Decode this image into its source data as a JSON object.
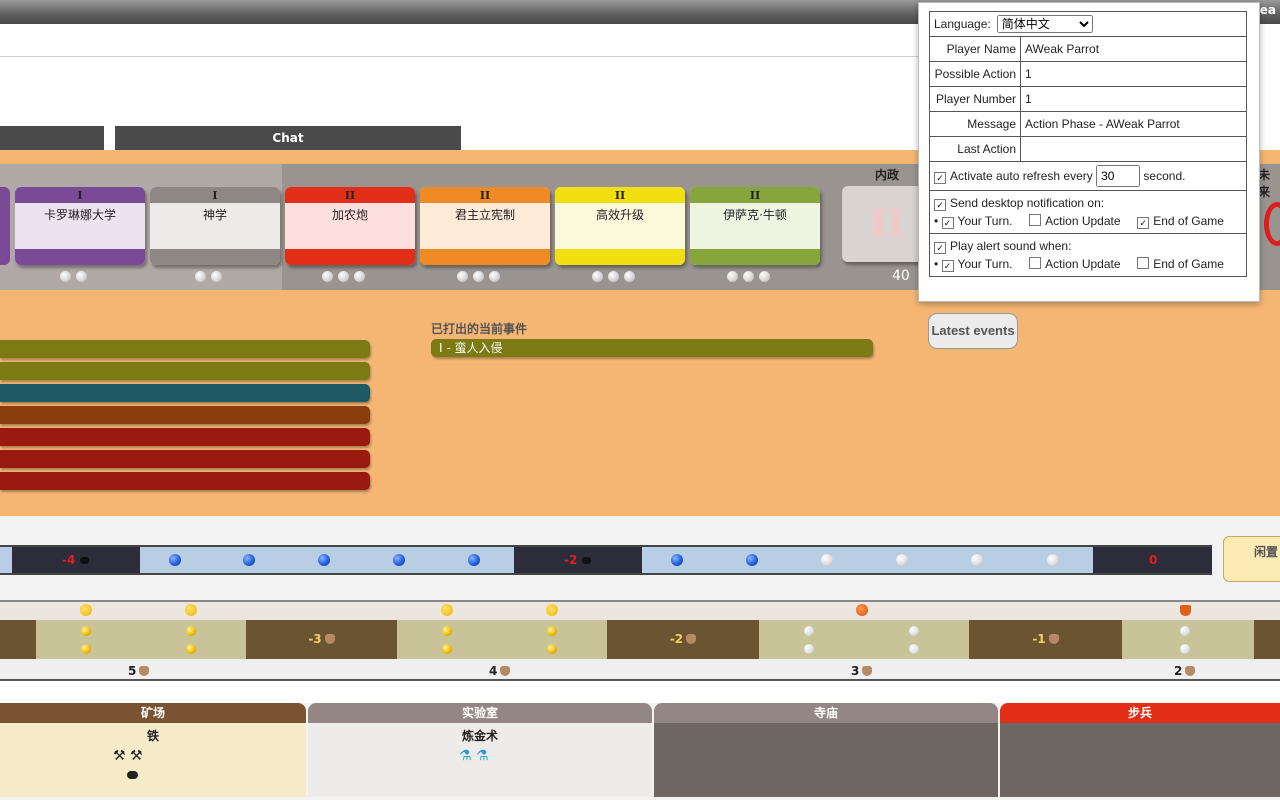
{
  "header": {
    "user_short": "AWea"
  },
  "tabs": {
    "chat": "Chat"
  },
  "cards": [
    {
      "age": "I",
      "name": "卡罗琳娜大学",
      "color": "#7b4a96",
      "body": "#ece2f0",
      "dots": 2
    },
    {
      "age": "I",
      "name": "神学",
      "color": "#8f8784",
      "body": "#ecebea",
      "dots": 2
    },
    {
      "age": "II",
      "name": "加农炮",
      "color": "#e22e16",
      "body": "#fde0de",
      "dots": 3
    },
    {
      "age": "II",
      "name": "君主立宪制",
      "color": "#ef8a24",
      "body": "#fdebd8",
      "dots": 3
    },
    {
      "age": "II",
      "name": "高效升级",
      "color": "#f2df12",
      "body": "#fcf8dc",
      "dots": 3
    },
    {
      "age": "II",
      "name": "伊萨克·牛顿",
      "color": "#86a53b",
      "body": "#eef3e2",
      "dots": 3
    }
  ],
  "civil_deck": {
    "label": "内政",
    "age": "II",
    "count": "40"
  },
  "future_label": "未来",
  "events": {
    "title": "已打出的当前事件",
    "current": "I - 蛮人入侵",
    "latest_button": "Latest events"
  },
  "left_bars": [
    "#7b7a13",
    "#7b7a13",
    "#1f5a64",
    "#8a3e10",
    "#9a1a10",
    "#9a1a10",
    "#9a1a10"
  ],
  "track": {
    "labels": [
      "-4",
      "-2",
      "0"
    ],
    "side_tab": "闲置"
  },
  "production": {
    "deficits": [
      "-3",
      "-2",
      "-1"
    ],
    "numbers": [
      "5",
      "4",
      "3",
      "2"
    ]
  },
  "buildings": [
    {
      "title": "矿场",
      "color": "#7a5432",
      "body": "#f6ebc8",
      "tech": "铁"
    },
    {
      "title": "实验室",
      "color": "#948683",
      "body": "#eeeceb",
      "tech": "炼金术"
    },
    {
      "title": "寺庙",
      "color": "#948683",
      "body": "#6d6661",
      "tech": ""
    },
    {
      "title": "步兵",
      "color": "#e22e16",
      "body": "#6d6661",
      "tech": ""
    }
  ],
  "settings": {
    "language_label": "Language:",
    "language_value": "简体中文",
    "player_name_label": "Player Name",
    "player_name": "AWeak Parrot",
    "possible_action_label": "Possible Action",
    "possible_action": "1",
    "player_number_label": "Player Number",
    "player_number": "1",
    "message_label": "Message",
    "message": "Action Phase - AWeak Parrot",
    "last_action_label": "Last Action",
    "last_action": "",
    "auto_refresh_label": "Activate auto refresh every",
    "auto_refresh_value": "30",
    "auto_refresh_unit": "second.",
    "notify_label": "Send desktop notification on:",
    "sound_label": "Play alert sound when:",
    "your_turn": "Your Turn.",
    "action_update": "Action Update",
    "end_of_game": "End of Game"
  }
}
